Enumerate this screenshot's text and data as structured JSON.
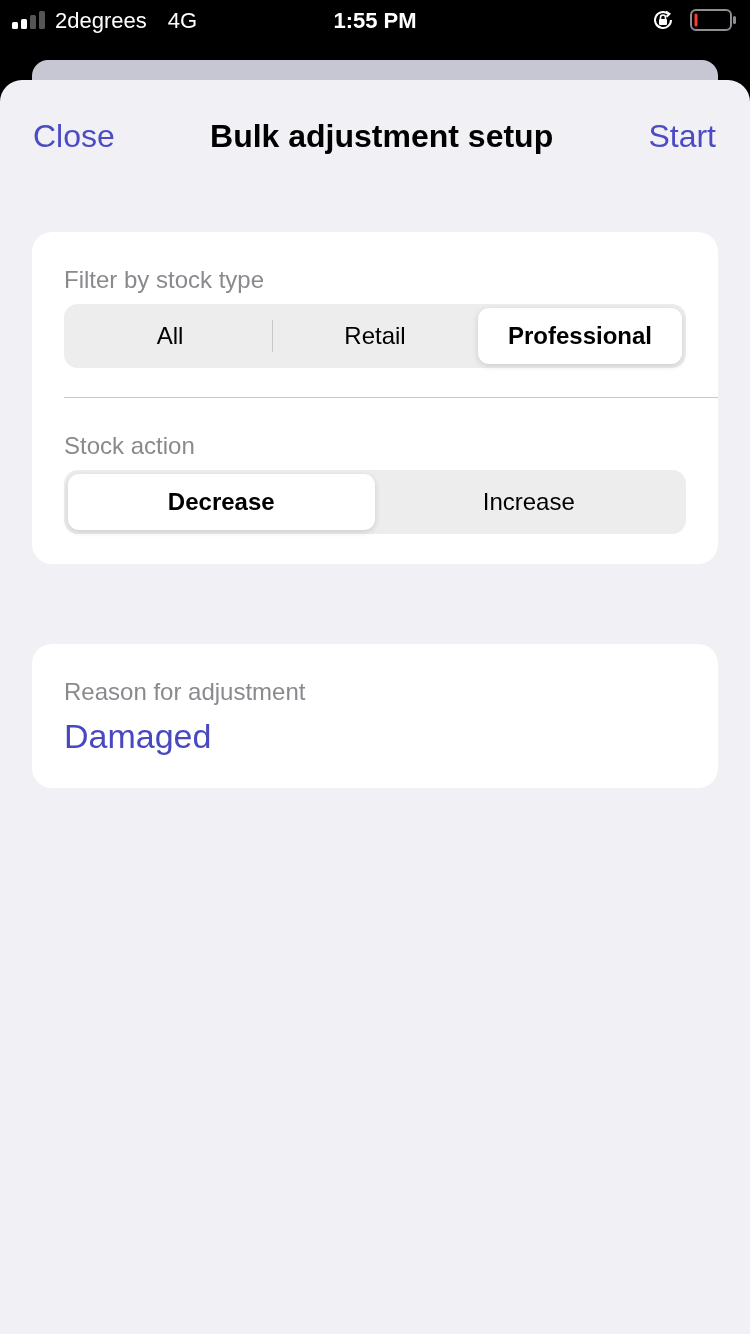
{
  "status_bar": {
    "carrier": "2degrees",
    "network": "4G",
    "time": "1:55 PM"
  },
  "nav_bar": {
    "left_button": "Close",
    "title": "Bulk adjustment setup",
    "right_button": "Start"
  },
  "setup_card": {
    "sections": [
      {
        "label": "Filter by stock type",
        "segments": [
          {
            "label": "All",
            "selected": false
          },
          {
            "label": "Retail",
            "selected": false
          },
          {
            "label": "Professional",
            "selected": true
          }
        ]
      },
      {
        "label": "Stock action",
        "segments": [
          {
            "label": "Decrease",
            "selected": true
          },
          {
            "label": "Increase",
            "selected": false
          }
        ]
      }
    ]
  },
  "reason_card": {
    "label": "Reason for adjustment",
    "value": "Damaged"
  }
}
